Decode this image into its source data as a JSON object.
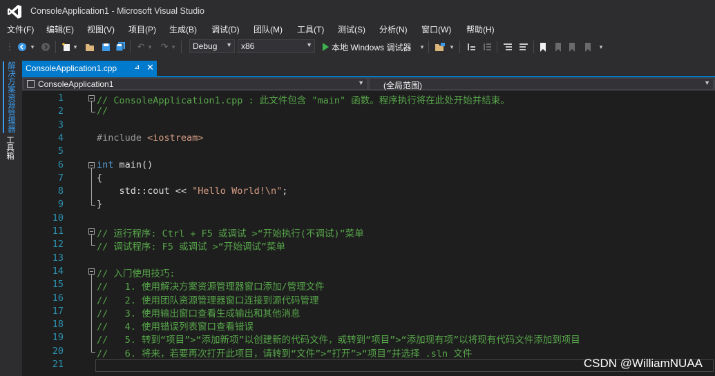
{
  "window": {
    "title": "ConsoleApplication1 - Microsoft Visual Studio"
  },
  "menu": [
    "文件(F)",
    "编辑(E)",
    "视图(V)",
    "项目(P)",
    "生成(B)",
    "调试(D)",
    "团队(M)",
    "工具(T)",
    "测试(S)",
    "分析(N)",
    "窗口(W)",
    "帮助(H)"
  ],
  "toolbar": {
    "configuration": "Debug",
    "platform": "x86",
    "run_label": "本地 Windows 调试器"
  },
  "side_tabs": {
    "solution_explorer": "解决方案资源管理器",
    "toolbox": "工具箱"
  },
  "document_tab": {
    "label": "ConsoleApplication1.cpp",
    "pin": "⊿",
    "close": "✕"
  },
  "navigation": {
    "project": "ConsoleApplication1",
    "scope": "(全局范围)"
  },
  "code_lines": [
    {
      "n": "1",
      "segments": [
        {
          "t": "// ConsoleApplication1.cpp : 此文件包含 \"main\" 函数。程序执行将在此处开始并结束。",
          "c": "comment"
        }
      ]
    },
    {
      "n": "2",
      "segments": [
        {
          "t": "//",
          "c": "comment"
        }
      ]
    },
    {
      "n": "3",
      "segments": []
    },
    {
      "n": "4",
      "segments": [
        {
          "t": "#include ",
          "c": "pre"
        },
        {
          "t": "<iostream>",
          "c": "str"
        }
      ]
    },
    {
      "n": "5",
      "segments": []
    },
    {
      "n": "6",
      "segments": [
        {
          "t": "int",
          "c": "kw"
        },
        {
          "t": " main()",
          "c": "plain"
        }
      ]
    },
    {
      "n": "7",
      "segments": [
        {
          "t": "{",
          "c": "plain"
        }
      ]
    },
    {
      "n": "8",
      "segments": [
        {
          "t": "    std::cout << ",
          "c": "plain"
        },
        {
          "t": "\"Hello World!\\n\"",
          "c": "str"
        },
        {
          "t": ";",
          "c": "plain"
        }
      ]
    },
    {
      "n": "9",
      "segments": [
        {
          "t": "}",
          "c": "plain"
        }
      ]
    },
    {
      "n": "10",
      "segments": []
    },
    {
      "n": "11",
      "segments": [
        {
          "t": "// 运行程序: Ctrl + F5 或调试 >“开始执行(不调试)”菜单",
          "c": "comment"
        }
      ]
    },
    {
      "n": "12",
      "segments": [
        {
          "t": "// 调试程序: F5 或调试 >“开始调试”菜单",
          "c": "comment"
        }
      ]
    },
    {
      "n": "13",
      "segments": []
    },
    {
      "n": "14",
      "segments": [
        {
          "t": "// 入门使用技巧:",
          "c": "comment"
        }
      ]
    },
    {
      "n": "15",
      "segments": [
        {
          "t": "//   1. 使用解决方案资源管理器窗口添加/管理文件",
          "c": "comment"
        }
      ]
    },
    {
      "n": "16",
      "segments": [
        {
          "t": "//   2. 使用团队资源管理器窗口连接到源代码管理",
          "c": "comment"
        }
      ]
    },
    {
      "n": "17",
      "segments": [
        {
          "t": "//   3. 使用输出窗口查看生成输出和其他消息",
          "c": "comment"
        }
      ]
    },
    {
      "n": "18",
      "segments": [
        {
          "t": "//   4. 使用错误列表窗口查看错误",
          "c": "comment"
        }
      ]
    },
    {
      "n": "19",
      "segments": [
        {
          "t": "//   5. 转到“项目”>“添加新项”以创建新的代码文件，或转到“项目”>“添加现有项”以将现有代码文件添加到项目",
          "c": "comment"
        }
      ]
    },
    {
      "n": "20",
      "segments": [
        {
          "t": "//   6. 将来，若要再次打开此项目，请转到“文件”>“打开”>“项目”并选择 .sln 文件",
          "c": "comment"
        }
      ]
    },
    {
      "n": "21",
      "segments": []
    }
  ],
  "watermark": "CSDN @WilliamNUAA",
  "colors": {
    "accent": "#007acc",
    "comment": "#57a64a",
    "keyword": "#569cd6",
    "string": "#d69d85",
    "line_number": "#2b91af"
  }
}
